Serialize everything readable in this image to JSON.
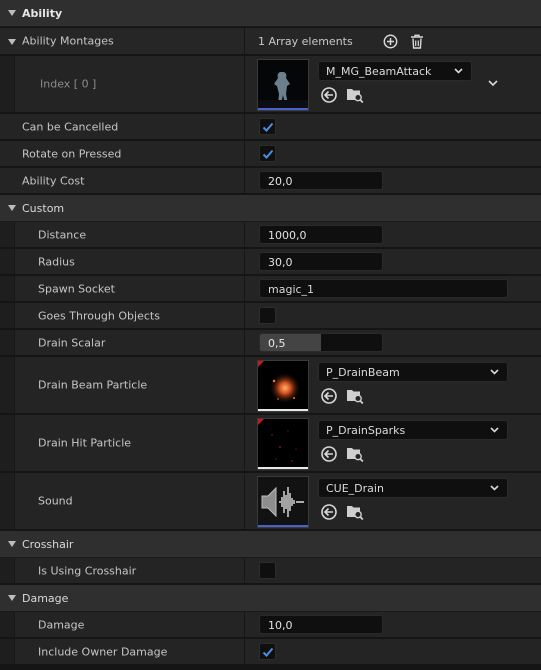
{
  "colors": {
    "accent_blue": "#4a7fd6",
    "check": "#4a8ee6"
  },
  "sections": {
    "ability": "Ability",
    "custom": "Custom",
    "crosshair": "Crosshair",
    "damage": "Damage"
  },
  "ability": {
    "montages_label": "Ability Montages",
    "montages_count": "1 Array elements",
    "index_label": "Index [ 0 ]",
    "montage_asset": "M_MG_BeamAttack",
    "can_be_cancelled_label": "Can be Cancelled",
    "can_be_cancelled": true,
    "rotate_on_pressed_label": "Rotate on Pressed",
    "rotate_on_pressed": true,
    "ability_cost_label": "Ability Cost",
    "ability_cost": "20,0"
  },
  "custom": {
    "distance_label": "Distance",
    "distance": "1000,0",
    "radius_label": "Radius",
    "radius": "30,0",
    "spawn_socket_label": "Spawn Socket",
    "spawn_socket": "magic_1",
    "goes_through_label": "Goes Through Objects",
    "goes_through": false,
    "drain_scalar_label": "Drain Scalar",
    "drain_scalar": "0,5",
    "drain_scalar_fraction": 0.5,
    "drain_beam_label": "Drain Beam Particle",
    "drain_beam_asset": "P_DrainBeam",
    "drain_hit_label": "Drain Hit Particle",
    "drain_hit_asset": "P_DrainSparks",
    "sound_label": "Sound",
    "sound_asset": "CUE_Drain"
  },
  "crosshair": {
    "is_using_label": "Is Using Crosshair",
    "is_using": false
  },
  "damage": {
    "damage_label": "Damage",
    "damage": "10,0",
    "include_owner_label": "Include Owner Damage",
    "include_owner": true
  }
}
